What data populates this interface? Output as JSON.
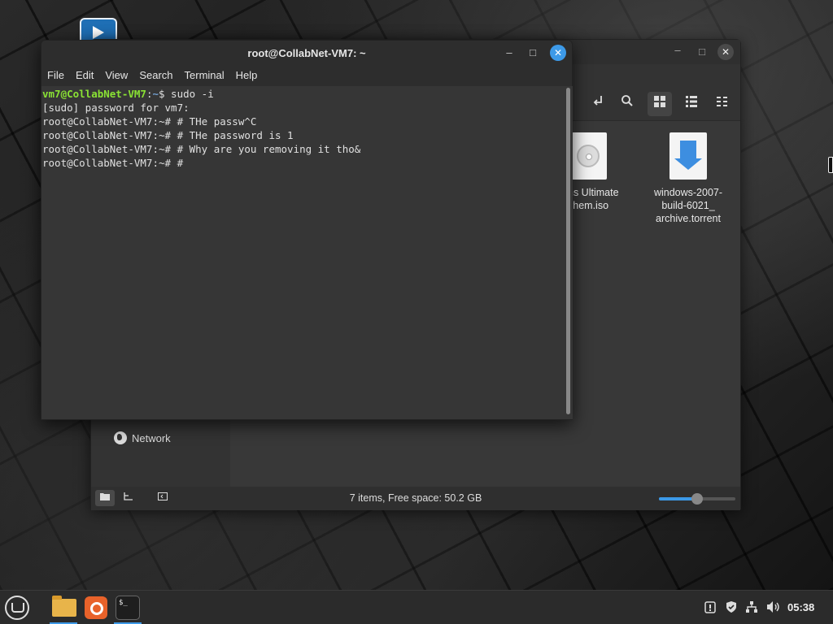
{
  "terminal": {
    "title": "root@CollabNet-VM7: ~",
    "window_controls": {
      "minimize": "–",
      "maximize": "□",
      "close": "✕"
    },
    "menu": [
      "File",
      "Edit",
      "View",
      "Search",
      "Terminal",
      "Help"
    ],
    "lines": [
      {
        "user": "vm7@CollabNet-VM7",
        "sep": ":",
        "path": "~",
        "text": "$ sudo -i"
      },
      {
        "text": "[sudo] password for vm7:"
      },
      {
        "text": "root@CollabNet-VM7:~# # THe passw^C"
      },
      {
        "text": "root@CollabNet-VM7:~# # THe password is 1"
      },
      {
        "text": "root@CollabNet-VM7:~# # Why are you removing it tho&"
      },
      {
        "text": "root@CollabNet-VM7:~# #"
      }
    ]
  },
  "file_manager": {
    "window_controls": {
      "minimize": "–",
      "maximize": "□",
      "close": "✕"
    },
    "sidebar": {
      "network_label": "Network"
    },
    "files": [
      {
        "name": "ns Ultimate\nyhem.iso",
        "icon": "disc-image-icon"
      },
      {
        "name": "windows-2007-\nbuild-6021_\narchive.torrent",
        "icon": "torrent-download-icon"
      }
    ],
    "status": "7 items, Free space: 50.2 GB",
    "zoom_level": 0.5
  },
  "taskbar": {
    "clock": "05:38",
    "apps": [
      "files-icon",
      "firefox-icon",
      "terminal-icon"
    ],
    "terminal_glyph": "$_"
  }
}
